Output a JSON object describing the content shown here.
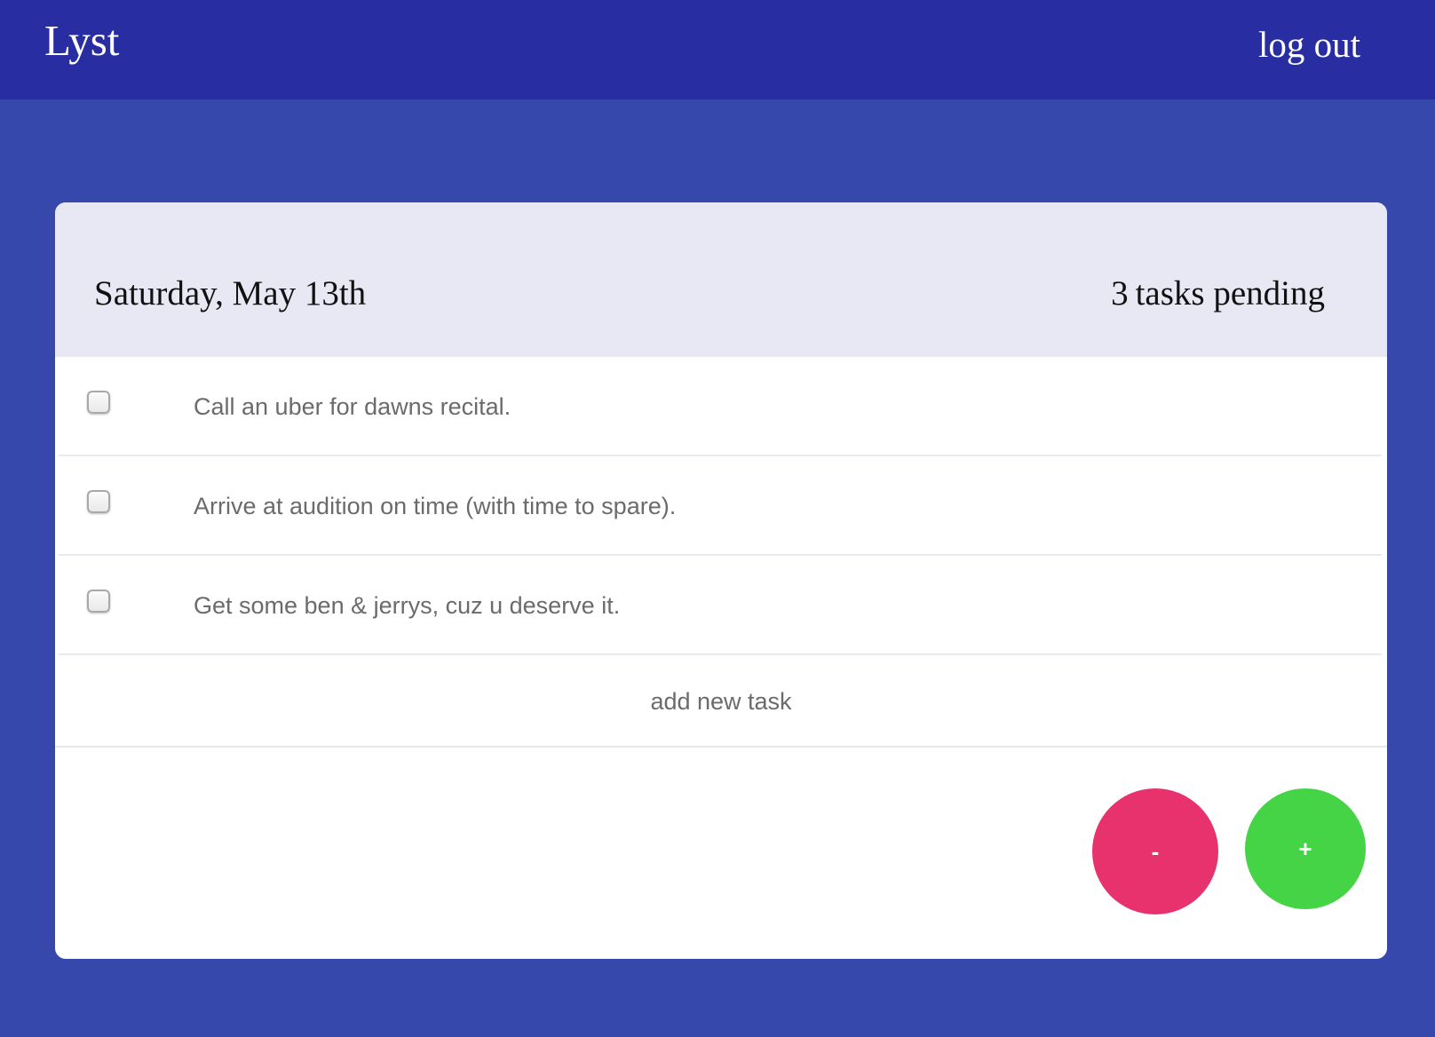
{
  "app": {
    "title": "Lyst",
    "logout_label": "log out"
  },
  "list": {
    "date_title": "Saturday, May 13th",
    "pending_count": "3",
    "pending_label": "tasks pending",
    "tasks": [
      {
        "text": "Call an uber for dawns recital.",
        "checked": false
      },
      {
        "text": "Arrive at audition on time (with time to spare).",
        "checked": false
      },
      {
        "text": "Get some ben & jerrys, cuz u deserve it.",
        "checked": false
      }
    ],
    "add_task_label": "add new task"
  },
  "actions": {
    "remove_label": "-",
    "add_label": "+"
  },
  "colors": {
    "topbar": "#282DA2",
    "background": "#3648AC",
    "card_header": "#E7E8F3",
    "remove_button": "#E8326E",
    "add_button": "#46D447"
  }
}
